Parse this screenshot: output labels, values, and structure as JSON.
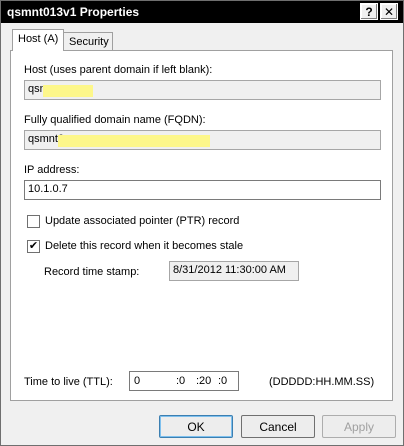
{
  "window": {
    "title": "qsmnt013v1 Properties",
    "help_button": "?",
    "close_button": "✕"
  },
  "tabs": [
    {
      "label": "Host (A)",
      "selected": true
    },
    {
      "label": "Security",
      "selected": false
    }
  ],
  "form": {
    "host_label": "Host (uses parent domain if left blank):",
    "host_value": "qsn",
    "fqdn_label": "Fully qualified domain name (FQDN):",
    "fqdn_value": "qsmnt0",
    "ip_label": "IP address:",
    "ip_value": "10.1.0.7",
    "ptr_label": "Update associated pointer (PTR) record",
    "ptr_checked": false,
    "stale_label": "Delete this record when it becomes stale",
    "stale_checked": true,
    "timestamp_label": "Record time stamp:",
    "timestamp_value": "8/31/2012 11:30:00 AM",
    "ttl_label": "Time to live (TTL):",
    "ttl_days": "0",
    "ttl_hours": ":0",
    "ttl_minutes": ":20",
    "ttl_seconds": ":0",
    "ttl_format": "(DDDDD:HH.MM.SS)"
  },
  "buttons": {
    "ok": "OK",
    "cancel": "Cancel",
    "apply": "Apply"
  },
  "colors": {
    "title_bar": "#000000",
    "redaction_highlight": "#fdf78a"
  }
}
